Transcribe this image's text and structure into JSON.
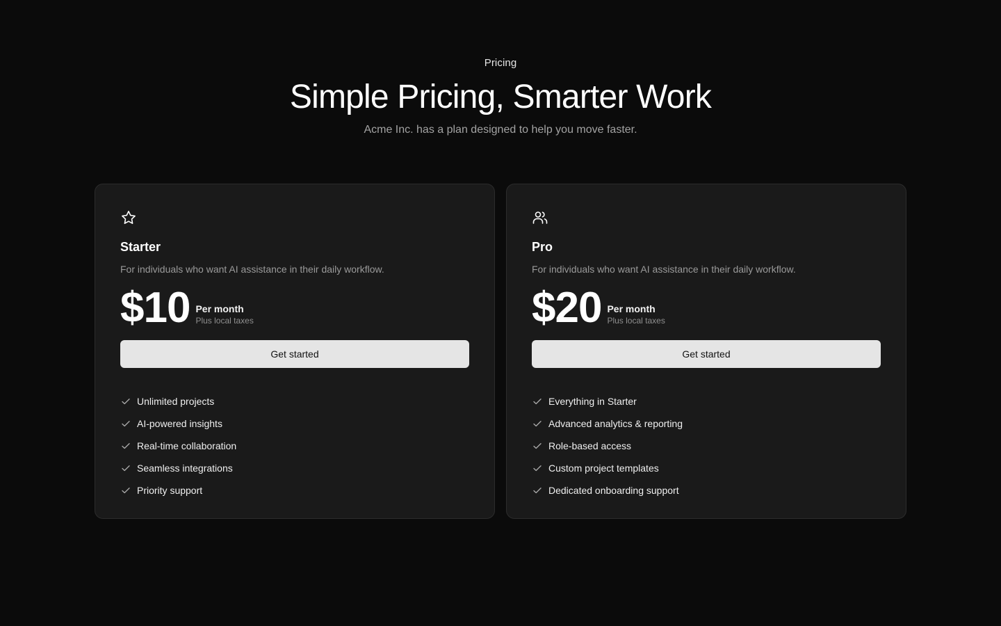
{
  "header": {
    "eyebrow": "Pricing",
    "title": "Simple Pricing, Smarter Work",
    "subtitle": "Acme Inc. has a plan designed to help you move faster."
  },
  "plans": [
    {
      "icon": "star-icon",
      "name": "Starter",
      "description": "For individuals who want AI assistance in their daily workflow.",
      "price": "$10",
      "period": "Per month",
      "tax_note": "Plus local taxes",
      "cta": "Get started",
      "features": [
        "Unlimited projects",
        "AI-powered insights",
        "Real-time collaboration",
        "Seamless integrations",
        "Priority support"
      ]
    },
    {
      "icon": "users-icon",
      "name": "Pro",
      "description": "For individuals who want AI assistance in their daily workflow.",
      "price": "$20",
      "period": "Per month",
      "tax_note": "Plus local taxes",
      "cta": "Get started",
      "features": [
        "Everything in Starter",
        "Advanced analytics & reporting",
        "Role-based access",
        "Custom project templates",
        "Dedicated onboarding support"
      ]
    }
  ],
  "colors": {
    "background": "#0b0b0b",
    "card": "#1a1a1a",
    "card_border": "#2c2c2c",
    "button": "#e5e5e5"
  }
}
